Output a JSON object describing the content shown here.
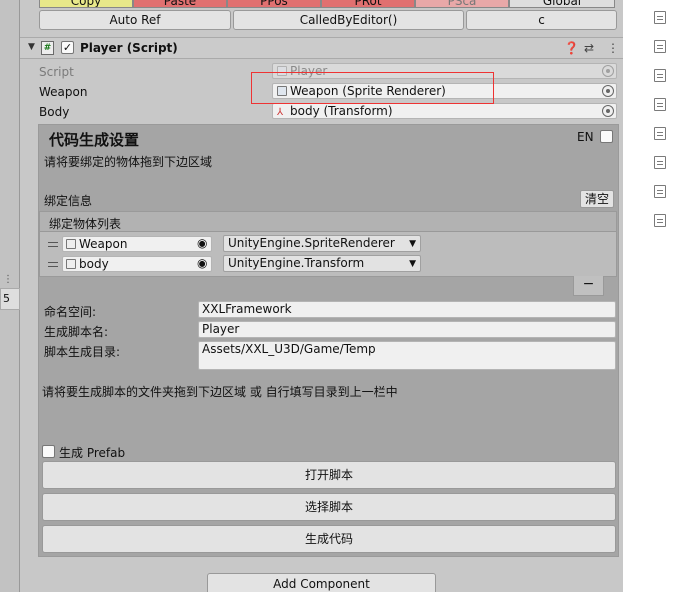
{
  "top_buttons": {
    "row1": [
      "Copy",
      "Paste",
      "PPos",
      "PRot",
      "PSca",
      "Global"
    ],
    "auto_ref": "Auto Ref",
    "called_by_editor": "CalledByEditor()",
    "c": "c"
  },
  "left_strip": {
    "number": "5"
  },
  "component": {
    "title": "Player (Script)",
    "enabled": true,
    "properties": [
      {
        "label": "Script",
        "value": "Player",
        "disabled": true
      },
      {
        "label": "Weapon",
        "value": "Weapon (Sprite Renderer)"
      },
      {
        "label": "Body",
        "value": "body (Transform)"
      }
    ]
  },
  "codegen": {
    "title": "代码生成设置",
    "lang_toggle": "EN",
    "drag_hint": "请将要绑定的物体拖到下边区域",
    "bind_info_label": "绑定信息",
    "clear_button": "清空",
    "list_header": "绑定物体列表",
    "bindings": [
      {
        "object": "Weapon",
        "type": "UnityEngine.SpriteRenderer"
      },
      {
        "object": "body",
        "type": "UnityEngine.Transform"
      }
    ],
    "remove_button": "−",
    "namespace_label": "命名空间:",
    "namespace_value": "XXLFramework",
    "script_name_label": "生成脚本名:",
    "script_name_value": "Player",
    "script_dir_label": "脚本生成目录:",
    "script_dir_value": "Assets/XXL_U3D/Game/Temp",
    "folder_hint": "请将要生成脚本的文件夹拖到下边区域 或 自行填写目录到上一栏中",
    "prefab_label": "生成 Prefab",
    "open_script": "打开脚本",
    "select_script": "选择脚本",
    "generate_code": "生成代码"
  },
  "add_component": "Add Component",
  "colors": {
    "copy_btn": "#e8e88a",
    "red_btn": "#e07070",
    "pink_btn": "#e8a8a8",
    "highlight": "#e33333"
  }
}
